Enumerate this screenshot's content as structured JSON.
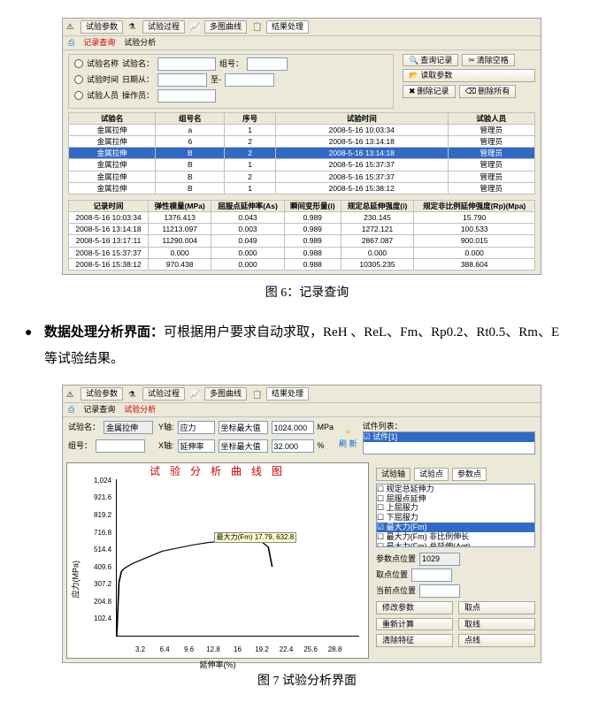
{
  "fig6": {
    "main_tabs": [
      "试验参数",
      "试验过程",
      "多图曲线",
      "结果处理"
    ],
    "sub_tabs": [
      "记录查询",
      "试验分析"
    ],
    "form": {
      "criteria_name_lbl": "试验名称",
      "test_name_lbl": "试验名：",
      "group_lbl": "组号：",
      "criteria_date_lbl": "试验时间",
      "date_from_lbl": "日期从：",
      "to_lbl": "至-",
      "criteria_person_lbl": "试验人员",
      "operator_lbl": "操作员：",
      "btn_query": "查询记录",
      "btn_clear": "清除空格",
      "btn_load": "读取参数",
      "btn_del": "删除记录",
      "btn_delall": "删除所有"
    },
    "grid1": {
      "headers": [
        "试验名",
        "组号名",
        "序号",
        "试验时间",
        "试验人员"
      ],
      "rows": [
        [
          "金属拉伸",
          "a",
          "1",
          "2008-5-16 10:03:34",
          "管理员"
        ],
        [
          "金属拉伸",
          "6",
          "2",
          "2008-5-16 13:14:18",
          "管理员"
        ],
        [
          "金属拉伸",
          "B",
          "2",
          "2008-5-16 13:14:18",
          "管理员"
        ],
        [
          "金属拉伸",
          "B",
          "1",
          "2008-5-16 15:37:37",
          "管理员"
        ],
        [
          "金属拉伸",
          "B",
          "2",
          "2008-5-16 15:37:37",
          "管理员"
        ],
        [
          "金属拉伸",
          "B",
          "1",
          "2008-5-16 15:38:12",
          "管理员"
        ]
      ],
      "selected_index": 2
    },
    "grid2": {
      "headers": [
        "记录时间",
        "弹性模量(MPa)",
        "屈服点延伸率(As)",
        "瞬间变形量(i)",
        "规定总延伸强度(i)",
        "规定非比例延伸强度(Rp)(Mpa)"
      ],
      "rows": [
        [
          "2008-5-16 10:03:34",
          "1376.413",
          "0.043",
          "0.989",
          "230.145",
          "15.790"
        ],
        [
          "2008-5-16 13:14:18",
          "11213.097",
          "0.003",
          "0.989",
          "1272.121",
          "100.533"
        ],
        [
          "2008-5-16 13:17:11",
          "11290.004",
          "0.049",
          "0.989",
          "2867.087",
          "900.015"
        ],
        [
          "2008-5-16 15:37:37",
          "0.000",
          "0.000",
          "0.988",
          "0.000",
          "0.000"
        ],
        [
          "2008-5-16 15:38:12",
          "970.438",
          "0.000",
          "0.988",
          "10305.235",
          "388.604"
        ]
      ]
    }
  },
  "caption6": "图 6：记录查询",
  "bullet": {
    "lead": "数据处理分析界面：",
    "body_a": "可根据用户要求自动求取，",
    "metrics": "ReH 、ReL、Fm、Rp0.2、Rt0.5、Rm、E",
    "body_b": "等试验结果。"
  },
  "fig7": {
    "main_tabs": [
      "试验参数",
      "试验过程",
      "多图曲线",
      "结果处理"
    ],
    "sub_tabs": [
      "记录查询",
      "试验分析"
    ],
    "top_form": {
      "test_name_lbl": "试验名：",
      "test_name_val": "金属拉伸",
      "group_lbl": "组号：",
      "y_axis_lbl": "Y轴:",
      "y_axis_val": "应力",
      "y_mode_lbl": "坐标最大值",
      "y_max_val": "1024.000",
      "y_unit": "MPa",
      "x_axis_lbl": "X轴:",
      "x_axis_val": "延伸率",
      "x_mode_lbl": "坐标最大值",
      "x_max_val": "32.000",
      "x_unit": "%",
      "refresh": "刷 新",
      "spec_list_lbl": "试件列表：",
      "spec_item": "试件[1]"
    },
    "annotation": "最大力(Fm) 17.79, 632.8",
    "chart": {
      "title": "试 验 分 析 曲 线 图",
      "ylabel": "应力(MPa)",
      "xlabel": "延伸率(%)",
      "y_ticks": [
        "102.4",
        "204.8",
        "307.2",
        "409.6",
        "514.4",
        "716.8",
        "819.2",
        "921.6",
        "1,024"
      ],
      "x_ticks": [
        "3.2",
        "6.4",
        "9.6",
        "12.8",
        "16",
        "19.2",
        "22.4",
        "25.6",
        "28.8"
      ]
    },
    "chart_data": {
      "type": "line",
      "title": "试验分析曲线图",
      "xlabel": "延伸率(%)",
      "ylabel": "应力(MPa)",
      "xlim": [
        0,
        32
      ],
      "ylim": [
        0,
        1024
      ],
      "series": [
        {
          "name": "试件[1]",
          "x": [
            0,
            0.3,
            0.6,
            1.0,
            2.0,
            4.0,
            6.0,
            8.0,
            10.0,
            12.0,
            14.0,
            16.0,
            17.79,
            19.0,
            20.0,
            20.5
          ],
          "y": [
            0,
            350,
            420,
            440,
            470,
            510,
            550,
            575,
            595,
            610,
            620,
            628,
            632.8,
            620,
            580,
            450
          ]
        }
      ],
      "annotations": [
        {
          "text": "最大力(Fm) 17.79, 632.8",
          "x": 17.79,
          "y": 632.8
        }
      ]
    },
    "right": {
      "mini_tabs": [
        "试验轴",
        "试验点",
        "参数点"
      ],
      "params": [
        "规定总延伸力",
        "屈服点延伸",
        "上屈服力",
        "下屈服力",
        "最大力(Fm)",
        "最大力(Fm) 非比例伸长",
        "最大力(Fm) 总延伸(Agt)"
      ],
      "point_pos_lbl": "参数点位置",
      "point_pos_val": "1029",
      "pick_pos_lbl": "取点位置",
      "cur_pos_lbl": "当前点位置",
      "btn_mod": "修改参数",
      "btn_pick": "取点",
      "btn_recalc": "重新计算",
      "btn_line": "取线",
      "btn_clear_feat": "清除特征",
      "btn_pts": "点线"
    }
  },
  "caption7": "图 7 试验分析界面"
}
